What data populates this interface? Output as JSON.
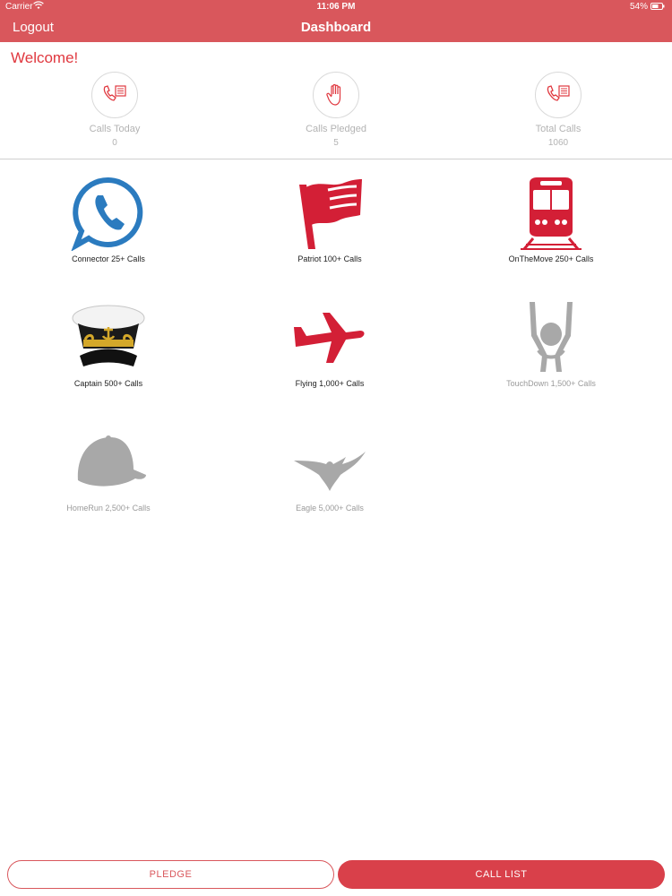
{
  "status_bar": {
    "carrier": "Carrier",
    "time": "11:06 PM",
    "battery": "54%"
  },
  "nav": {
    "logout_label": "Logout",
    "title": "Dashboard"
  },
  "welcome": "Welcome!",
  "stats": [
    {
      "label": "Calls Today",
      "value": "0",
      "icon": "phone-list-icon"
    },
    {
      "label": "Calls Pledged",
      "value": "5",
      "icon": "raised-hand-icon"
    },
    {
      "label": "Total Calls",
      "value": "1060",
      "icon": "phone-list-icon"
    }
  ],
  "badges": [
    {
      "caption": "Connector 25+ Calls",
      "icon": "phone-bubble-icon",
      "earned": true
    },
    {
      "caption": "Patriot 100+ Calls",
      "icon": "flag-icon",
      "earned": true
    },
    {
      "caption": "OnTheMove 250+ Calls",
      "icon": "train-icon",
      "earned": true
    },
    {
      "caption": "Captain 500+ Calls",
      "icon": "captain-hat-icon",
      "earned": true
    },
    {
      "caption": "Flying 1,000+ Calls",
      "icon": "airplane-icon",
      "earned": true
    },
    {
      "caption": "TouchDown 1,500+ Calls",
      "icon": "touchdown-icon",
      "earned": false
    },
    {
      "caption": "HomeRun 2,500+ Calls",
      "icon": "baseball-cap-icon",
      "earned": false
    },
    {
      "caption": "Eagle 5,000+ Calls",
      "icon": "eagle-icon",
      "earned": false
    }
  ],
  "buttons": {
    "pledge": "PLEDGE",
    "call_list": "CALL LIST"
  },
  "colors": {
    "brand": "#d9575c",
    "accent_red": "#e0383f",
    "icon_blue": "#2b7bbf",
    "locked_gray": "#a8a8a8"
  }
}
